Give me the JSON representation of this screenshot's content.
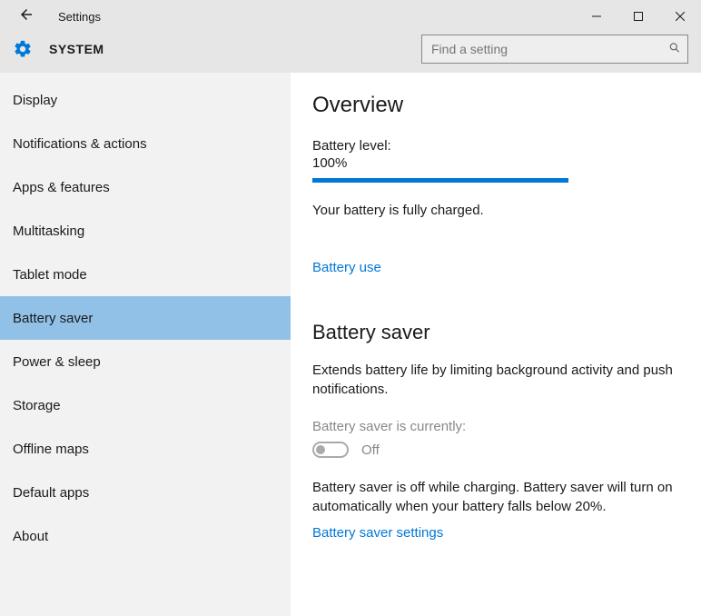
{
  "window": {
    "title": "Settings"
  },
  "header": {
    "system_label": "SYSTEM",
    "search_placeholder": "Find a setting"
  },
  "sidebar": {
    "items": [
      {
        "label": "Display"
      },
      {
        "label": "Notifications & actions"
      },
      {
        "label": "Apps & features"
      },
      {
        "label": "Multitasking"
      },
      {
        "label": "Tablet mode"
      },
      {
        "label": "Battery saver"
      },
      {
        "label": "Power & sleep"
      },
      {
        "label": "Storage"
      },
      {
        "label": "Offline maps"
      },
      {
        "label": "Default apps"
      },
      {
        "label": "About"
      }
    ],
    "selected_index": 5
  },
  "main": {
    "overview": {
      "heading": "Overview",
      "level_label": "Battery level:",
      "level_value": "100%",
      "progress_percent": 100,
      "status": "Your battery is fully charged.",
      "battery_use_link": "Battery use"
    },
    "saver": {
      "heading": "Battery saver",
      "description": "Extends battery life by limiting background activity and push notifications.",
      "currently_label": "Battery saver is currently:",
      "toggle_state": "Off",
      "toggle_on": false,
      "note": "Battery saver is off while charging. Battery saver will turn on automatically when your battery falls below 20%.",
      "settings_link": "Battery saver settings"
    }
  },
  "colors": {
    "accent": "#0078d7",
    "selected": "#91c1e7"
  }
}
